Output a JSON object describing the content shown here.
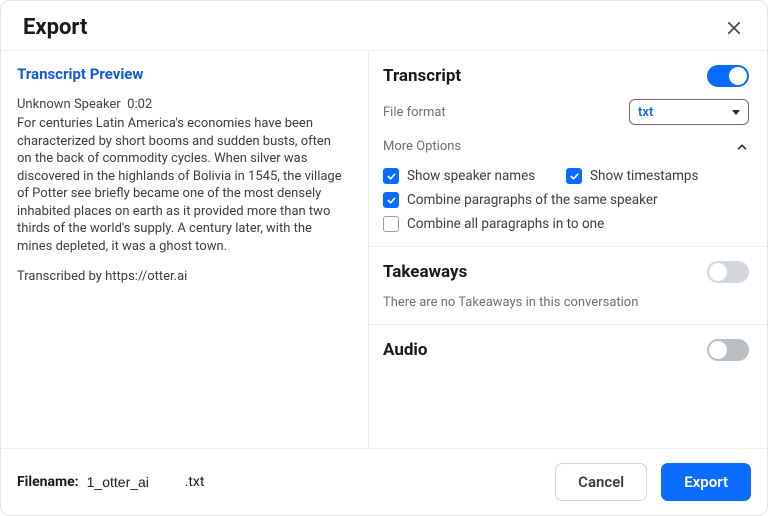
{
  "dialog": {
    "title": "Export",
    "close_label": "Close"
  },
  "preview": {
    "title": "Transcript Preview",
    "speaker": "Unknown Speaker",
    "timestamp": "0:02",
    "body": "For centuries Latin America's economies have been characterized by short booms and sudden busts, often on the back of commodity cycles. When silver was discovered in the highlands of Bolivia in 1545, the village of Potter see briefly became one of the most densely inhabited places on earth as it provided more than two thirds of the world's supply. A century later, with the mines depleted, it was a ghost town.",
    "footer": "Transcribed by https://otter.ai"
  },
  "transcript": {
    "title": "Transcript",
    "enabled": true,
    "file_format_label": "File format",
    "file_format_value": "txt",
    "more_options_label": "More Options",
    "options": {
      "show_speaker_names": {
        "label": "Show speaker names",
        "checked": true
      },
      "show_timestamps": {
        "label": "Show timestamps",
        "checked": true
      },
      "combine_same_speaker": {
        "label": "Combine paragraphs of the same speaker",
        "checked": true
      },
      "combine_all": {
        "label": "Combine all paragraphs in to one",
        "checked": false
      }
    }
  },
  "takeaways": {
    "title": "Takeaways",
    "enabled": false,
    "note": "There are no Takeaways in this conversation"
  },
  "audio": {
    "title": "Audio",
    "enabled": false
  },
  "footer": {
    "filename_label": "Filename:",
    "filename_value": "1_otter_ai",
    "filename_ext": ".txt",
    "cancel_label": "Cancel",
    "export_label": "Export"
  },
  "colors": {
    "accent": "#0a6cff",
    "link": "#1059d6",
    "border": "#ebedef",
    "muted": "#6a6f78"
  }
}
